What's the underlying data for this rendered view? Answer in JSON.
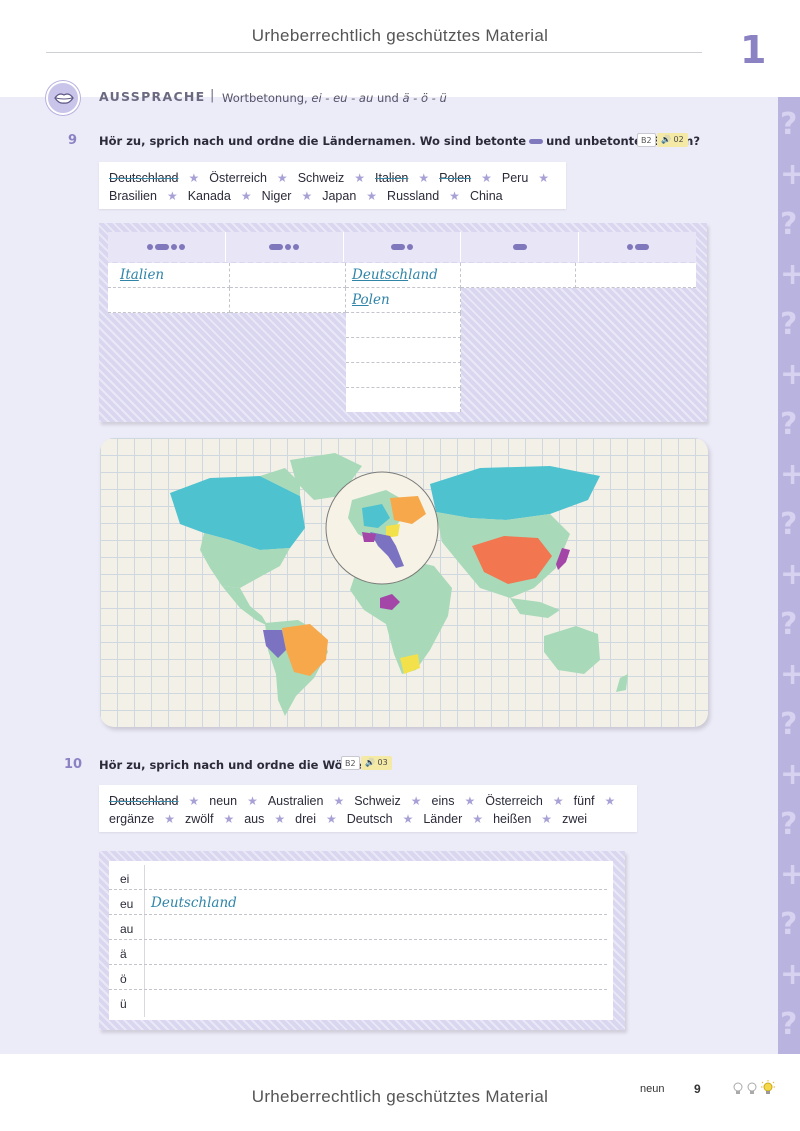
{
  "header": {
    "watermark": "Urheberrechtlich geschütztes Material",
    "chapter": "1"
  },
  "section": {
    "icon": "lips-icon",
    "title": "AUSSPRACHE",
    "separator": "|",
    "subtitle_plain": "Wortbetonung,",
    "subtitle_italic_1": "ei - eu - au",
    "subtitle_and": "und",
    "subtitle_italic_2": "ä - ö - ü"
  },
  "ex9": {
    "number": "9",
    "instruction_a": "Hör zu, sprich nach und ordne die Ländernamen. Wo sind betonte",
    "instruction_b": "und unbetonte",
    "instruction_c": "Silben?",
    "badge_level": "B2",
    "badge_audio": "02",
    "words_line1": [
      {
        "text": "Deutschland",
        "done": true
      },
      {
        "text": "Österreich",
        "done": false
      },
      {
        "text": "Schweiz",
        "done": false
      },
      {
        "text": "Italien",
        "done": true
      },
      {
        "text": "Polen",
        "done": true
      },
      {
        "text": "Peru",
        "done": false
      }
    ],
    "words_line2": [
      {
        "text": "Brasilien"
      },
      {
        "text": "Kanada"
      },
      {
        "text": "Niger"
      },
      {
        "text": "Japan"
      },
      {
        "text": "Russland"
      },
      {
        "text": "China"
      }
    ],
    "answers": {
      "col1_row1_stressed": "Ita",
      "col1_row1_rest": "lien",
      "col3_row1_stressed": "Deutsch",
      "col3_row1_rest": "land",
      "col3_row2_stressed": "Po",
      "col3_row2_rest": "len"
    }
  },
  "map": {
    "icon": "world-map-icon"
  },
  "ex10": {
    "number": "10",
    "instruction": "Hör zu, sprich nach und ordne die Wörter.",
    "badge_level": "B2",
    "badge_audio": "03",
    "words_line1": [
      {
        "text": "Deutschland",
        "done": true
      },
      {
        "text": "neun",
        "done": false
      },
      {
        "text": "Australien",
        "done": false
      },
      {
        "text": "Schweiz",
        "done": false
      },
      {
        "text": "eins",
        "done": false
      },
      {
        "text": "Österreich",
        "done": false
      },
      {
        "text": "fünf",
        "done": false
      }
    ],
    "words_line2": [
      {
        "text": "ergänze"
      },
      {
        "text": "zwölf"
      },
      {
        "text": "aus"
      },
      {
        "text": "drei"
      },
      {
        "text": "Deutsch"
      },
      {
        "text": "Länder"
      },
      {
        "text": "heißen"
      },
      {
        "text": "zwei"
      }
    ],
    "rows": [
      "ei",
      "eu",
      "au",
      "ä",
      "ö",
      "ü"
    ],
    "answer_eu": "Deutschland"
  },
  "footer": {
    "watermark": "Urheberrechtlich geschütztes Material",
    "page_word": "neun",
    "page_number": "9"
  }
}
